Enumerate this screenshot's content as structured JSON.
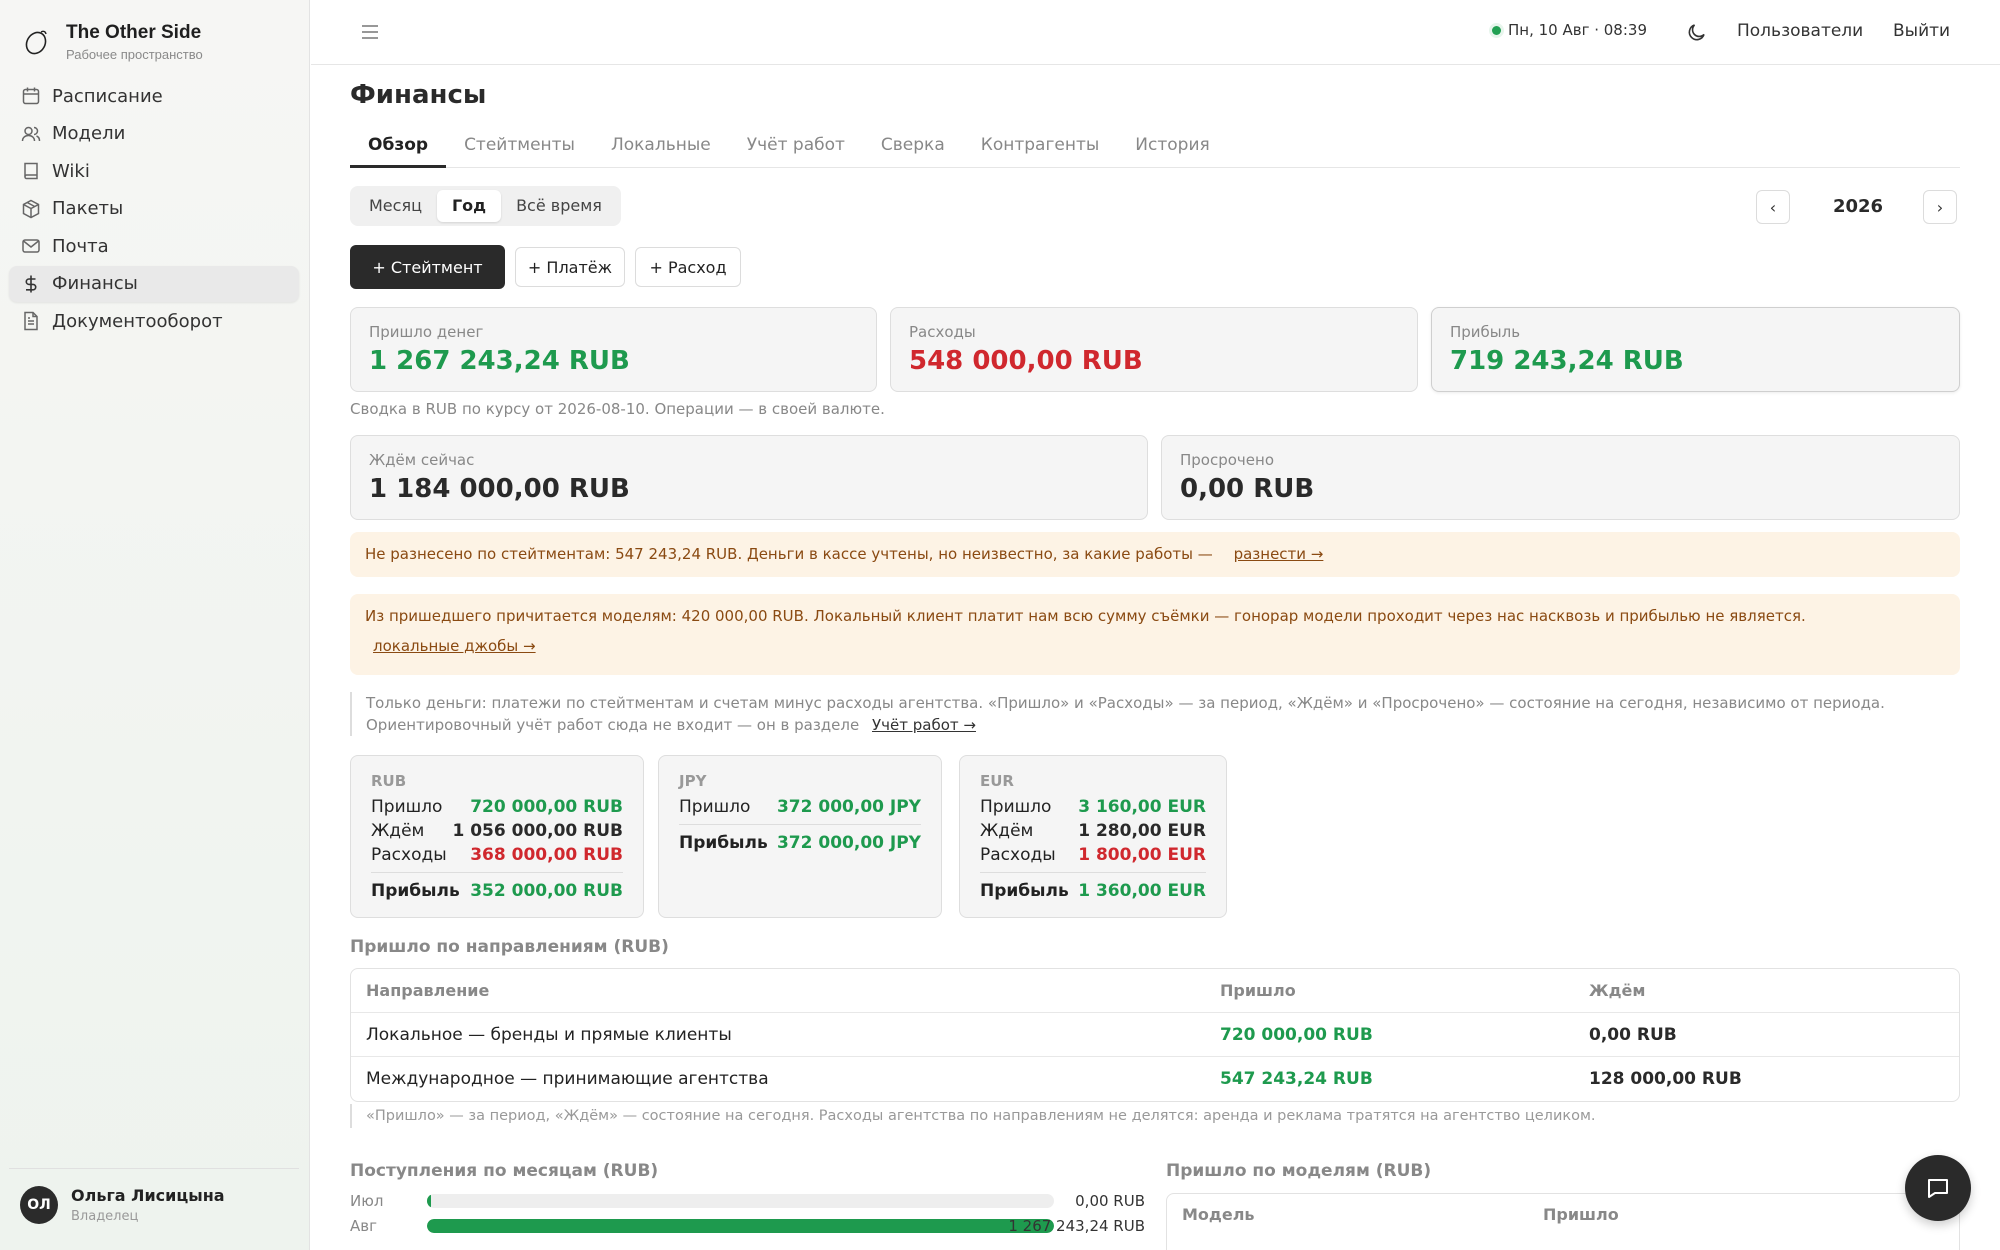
{
  "brand": {
    "title": "The Other Side",
    "subtitle": "Рабочее пространство"
  },
  "sidebar": {
    "items": [
      {
        "label": "Расписание",
        "icon": "calendar-icon"
      },
      {
        "label": "Модели",
        "icon": "users-icon"
      },
      {
        "label": "Wiki",
        "icon": "book-icon"
      },
      {
        "label": "Пакеты",
        "icon": "package-icon"
      },
      {
        "label": "Почта",
        "icon": "mail-icon"
      },
      {
        "label": "Финансы",
        "icon": "dollar-icon",
        "active": true
      },
      {
        "label": "Документооборот",
        "icon": "document-icon"
      }
    ]
  },
  "user": {
    "initials": "ОЛ",
    "name": "Ольга Лисицына",
    "role": "Владелец"
  },
  "topbar": {
    "datetime": "Пн, 10 Авг · 08:39",
    "users_link": "Пользователи",
    "logout_link": "Выйти"
  },
  "page": {
    "title": "Финансы"
  },
  "tabs": [
    "Обзор",
    "Стейтменты",
    "Локальные",
    "Учёт работ",
    "Сверка",
    "Контрагенты",
    "История"
  ],
  "period": {
    "options": [
      "Месяц",
      "Год",
      "Всё время"
    ],
    "selected": "Год",
    "year": "2026",
    "prev": "‹",
    "next": "›"
  },
  "actions": {
    "statement": "+ Стейтмент",
    "payment": "+ Платёж",
    "expense": "+ Расход"
  },
  "summary": {
    "income_label": "Пришло денег",
    "income_value": "1 267 243,24 RUB",
    "expenses_label": "Расходы",
    "expenses_value": "548 000,00 RUB",
    "profit_label": "Прибыль",
    "profit_value": "719 243,24 RUB",
    "note": "Сводка в RUB по курсу от 2026-08-10. Операции — в своей валюте.",
    "waiting_label": "Ждём сейчас",
    "waiting_value": "1 184 000,00 RUB",
    "overdue_label": "Просрочено",
    "overdue_value": "0,00 RUB"
  },
  "alerts": {
    "unallocated_text": "Не разнесено по стейтментам: 547 243,24 RUB. Деньги в кассе учтены, но неизвестно, за какие работы —",
    "unallocated_link": "разнести →",
    "models_text": "Из пришедшего причитается моделям: 420 000,00 RUB. Локальный клиент платит нам всю сумму съёмки — гонорар модели проходит через нас насквозь и прибылью не является.",
    "models_link": "локальные джобы →"
  },
  "info": {
    "line1": "Только деньги: платежи по стейтментам и счетам минус расходы агентства. «Пришло» и «Расходы» — за период, «Ждём» и «Просрочено» — состояние на сегодня, независимо от периода.",
    "line2": "Ориентировочный учёт работ сюда не входит — он в разделе",
    "link": "Учёт работ →"
  },
  "currencies": [
    {
      "code": "RUB",
      "rows": [
        {
          "label": "Пришло",
          "value": "720 000,00 RUB",
          "color": "green"
        },
        {
          "label": "Ждём",
          "value": "1 056 000,00 RUB",
          "color": "dark"
        },
        {
          "label": "Расходы",
          "value": "368 000,00 RUB",
          "color": "red"
        }
      ],
      "profit_label": "Прибыль",
      "profit_value": "352 000,00 RUB"
    },
    {
      "code": "JPY",
      "rows": [
        {
          "label": "Пришло",
          "value": "372 000,00 JPY",
          "color": "green"
        }
      ],
      "profit_label": "Прибыль",
      "profit_value": "372 000,00 JPY"
    },
    {
      "code": "EUR",
      "rows": [
        {
          "label": "Пришло",
          "value": "3 160,00 EUR",
          "color": "green"
        },
        {
          "label": "Ждём",
          "value": "1 280,00 EUR",
          "color": "dark"
        },
        {
          "label": "Расходы",
          "value": "1 800,00 EUR",
          "color": "red"
        }
      ],
      "profit_label": "Прибыль",
      "profit_value": "1 360,00 EUR"
    }
  ],
  "directions": {
    "title": "Пришло по направлениям (RUB)",
    "headers": [
      "Направление",
      "Пришло",
      "Ждём"
    ],
    "rows": [
      [
        "Локальное — бренды и прямые клиенты",
        "720 000,00 RUB",
        "0,00 RUB"
      ],
      [
        "Международное — принимающие агентства",
        "547 243,24 RUB",
        "128 000,00 RUB"
      ]
    ],
    "note": "«Пришло» — за период, «Ждём» — состояние на сегодня. Расходы агентства по направлениям не делятся: аренда и реклама тратятся на агентство целиком."
  },
  "monthly": {
    "title": "Поступления по месяцам (RUB)",
    "rows": [
      {
        "month": "Июл",
        "value_text": "0,00 RUB",
        "value": 0
      },
      {
        "month": "Авг",
        "value_text": "1 267 243,24 RUB",
        "value": 1267243.24
      }
    ]
  },
  "by_model": {
    "title": "Пришло по моделям (RUB)",
    "headers": [
      "Модель",
      "Пришло"
    ]
  },
  "colors": {
    "green": "#1e9a4e",
    "red": "#d0282e",
    "dark": "#2a2a2a",
    "alert_bg": "#fdf3e5"
  }
}
